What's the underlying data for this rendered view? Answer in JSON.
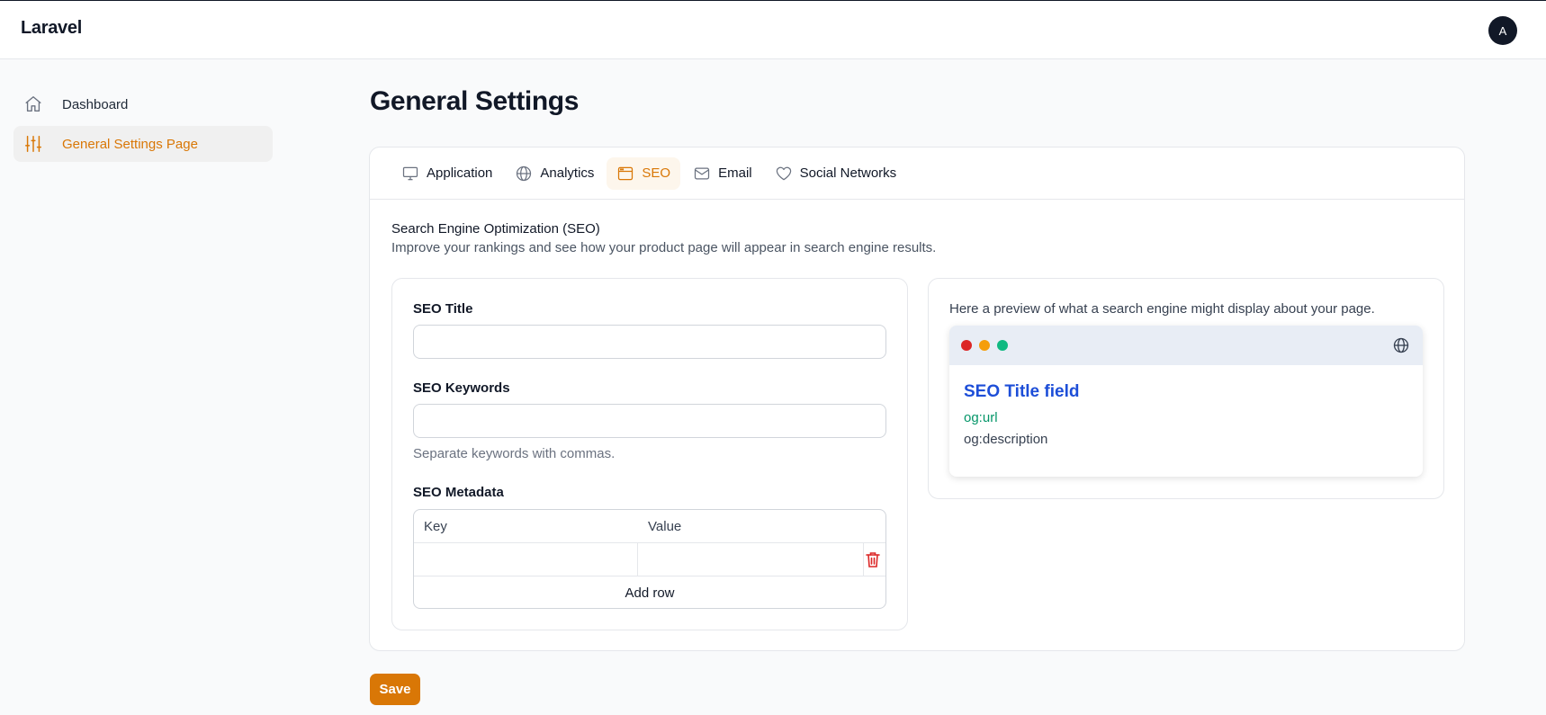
{
  "app": {
    "brand": "Laravel",
    "avatar_initial": "A"
  },
  "sidebar": {
    "items": [
      {
        "label": "Dashboard",
        "icon": "home-icon",
        "active": false
      },
      {
        "label": "General Settings Page",
        "icon": "sliders-icon",
        "active": true
      }
    ]
  },
  "page": {
    "title": "General Settings"
  },
  "tabs": [
    {
      "label": "Application",
      "icon": "monitor-icon",
      "active": false
    },
    {
      "label": "Analytics",
      "icon": "globe-icon",
      "active": false
    },
    {
      "label": "SEO",
      "icon": "browser-window-icon",
      "active": true
    },
    {
      "label": "Email",
      "icon": "envelope-icon",
      "active": false
    },
    {
      "label": "Social Networks",
      "icon": "heart-icon",
      "active": false
    }
  ],
  "seo": {
    "section_title": "Search Engine Optimization (SEO)",
    "section_desc": "Improve your rankings and see how your product page will appear in search engine results.",
    "title_label": "SEO Title",
    "title_value": "",
    "keywords_label": "SEO Keywords",
    "keywords_value": "",
    "keywords_hint": "Separate keywords with commas.",
    "metadata_label": "SEO Metadata",
    "metadata": {
      "columns": [
        "Key",
        "Value"
      ],
      "rows": [
        {
          "key": "",
          "value": ""
        }
      ],
      "add_row_label": "Add row"
    }
  },
  "preview": {
    "note": "Here a preview of what a search engine might display about your page.",
    "title": "SEO Title field",
    "url": "og:url",
    "description": "og:description",
    "dots": [
      "#dc2626",
      "#f59e0b",
      "#10b981"
    ]
  },
  "actions": {
    "save_label": "Save"
  },
  "colors": {
    "accent": "#d97706",
    "link": "#1d4ed8",
    "url": "#059669",
    "danger": "#dc2626"
  }
}
